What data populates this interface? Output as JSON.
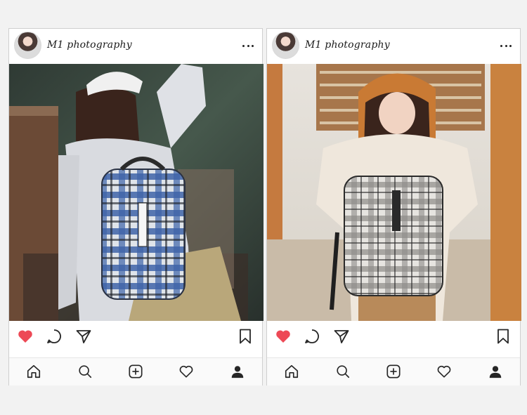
{
  "posts": [
    {
      "account": {
        "name": "M1 photography"
      },
      "icons": {
        "more": "more-options-icon",
        "like": "heart-icon",
        "comment": "comment-icon",
        "share": "share-icon",
        "save": "bookmark-icon"
      },
      "nav": [
        "home-icon",
        "search-icon",
        "add-post-icon",
        "activity-heart-icon",
        "profile-icon"
      ],
      "colors": {
        "liked": "#ed4956",
        "icon": "#262626"
      }
    },
    {
      "account": {
        "name": "M1 photography"
      },
      "icons": {
        "more": "more-options-icon",
        "like": "heart-icon",
        "comment": "comment-icon",
        "share": "share-icon",
        "save": "bookmark-icon"
      },
      "nav": [
        "home-icon",
        "search-icon",
        "add-post-icon",
        "activity-heart-icon",
        "profile-icon"
      ],
      "colors": {
        "liked": "#ed4956",
        "icon": "#262626"
      }
    }
  ]
}
